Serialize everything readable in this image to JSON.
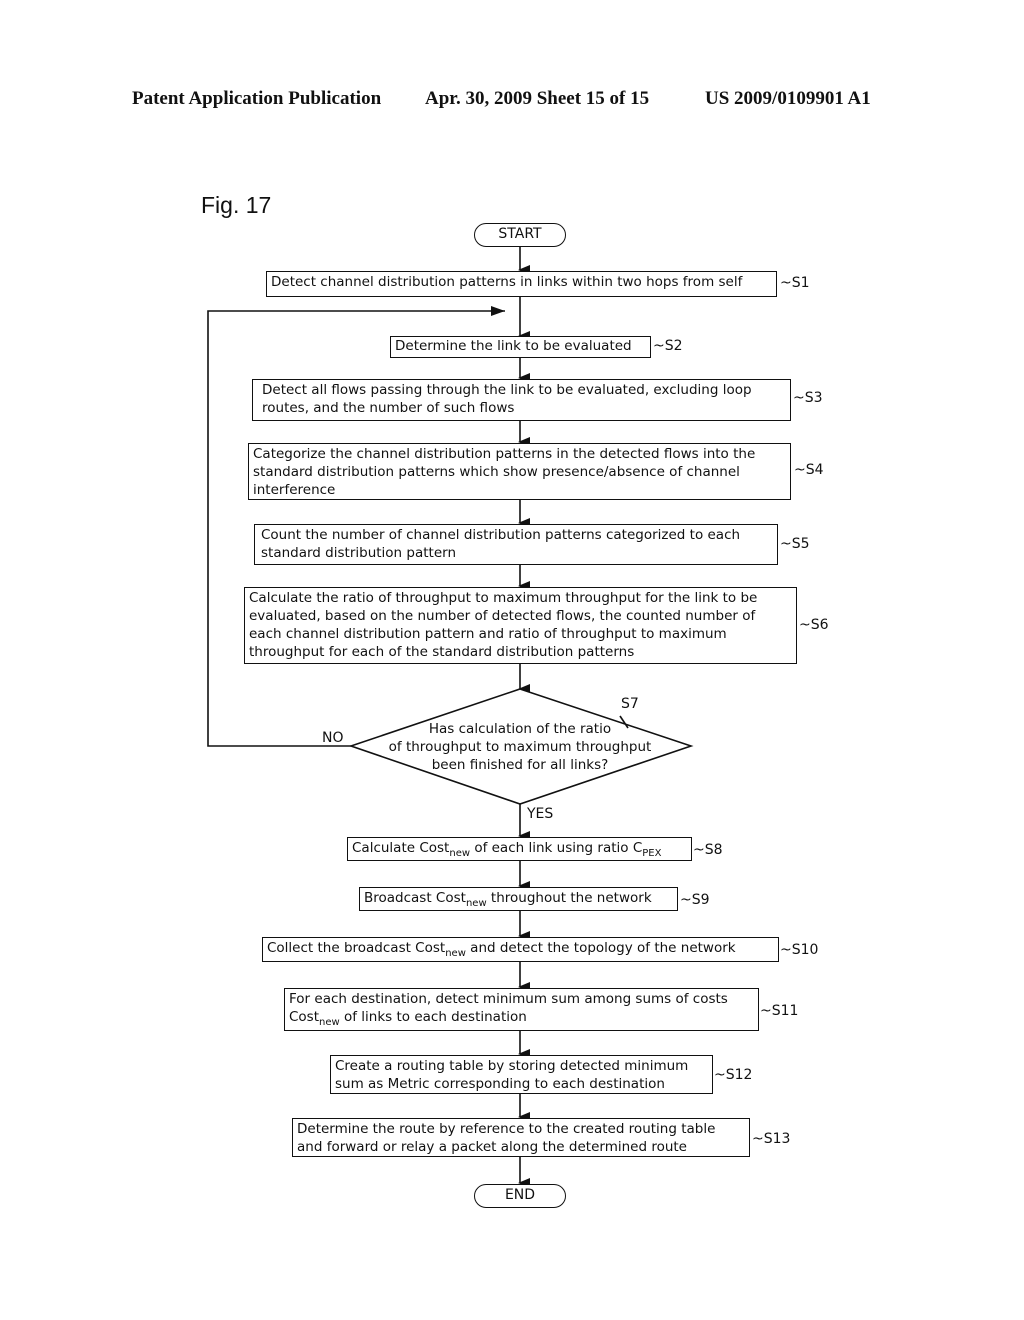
{
  "header": {
    "publication": "Patent Application Publication",
    "date_sheet": "Apr. 30, 2009  Sheet 15 of 15",
    "number": "US 2009/0109901 A1"
  },
  "figure": {
    "label": "Fig. 17",
    "start": "START",
    "end": "END",
    "steps": [
      {
        "id": "S1",
        "text": "Detect channel distribution patterns in links within two hops from self"
      },
      {
        "id": "S2",
        "text": "Determine the link to be evaluated"
      },
      {
        "id": "S3",
        "lines": [
          "Detect all flows passing through the link to be evaluated, excluding loop",
          "routes, and the number of such flows"
        ]
      },
      {
        "id": "S4",
        "lines": [
          "Categorize the channel distribution patterns in the detected flows into the",
          "standard distribution patterns which show presence/absence of channel",
          "interference"
        ]
      },
      {
        "id": "S5",
        "lines": [
          "Count the number of channel distribution patterns categorized to each",
          "standard distribution pattern"
        ]
      },
      {
        "id": "S6",
        "lines": [
          "Calculate the ratio of throughput to maximum throughput for the link to be",
          "evaluated, based on the number of detected flows, the counted number of",
          "each channel distribution pattern and ratio of throughput to maximum",
          "throughput for each of the standard distribution patterns"
        ]
      },
      {
        "id": "S7",
        "lines": [
          "Has calculation of the ratio",
          "of throughput to maximum throughput",
          "been finished for all links?"
        ],
        "no_label": "NO",
        "yes_label": "YES"
      },
      {
        "id": "S8",
        "pre": "Calculate Cost",
        "sub1": "new",
        "mid": " of each link using ratio C",
        "sub2": "PEX"
      },
      {
        "id": "S9",
        "pre": "Broadcast Cost",
        "sub1": "new",
        "mid": " throughout the network"
      },
      {
        "id": "S10",
        "pre": "Collect the broadcast Cost",
        "sub1": "new",
        "mid": " and detect the topology of the network"
      },
      {
        "id": "S11",
        "line1": "For each destination, detect minimum sum among sums of costs",
        "pre": "Cost",
        "sub1": "new",
        "mid": " of links to each destination"
      },
      {
        "id": "S12",
        "lines": [
          "Create a routing table by storing detected minimum",
          "sum as Metric corresponding to each destination"
        ]
      },
      {
        "id": "S13",
        "lines": [
          "Determine the route by reference to the created routing table",
          "and forward or relay a packet along the determined route"
        ]
      }
    ]
  }
}
